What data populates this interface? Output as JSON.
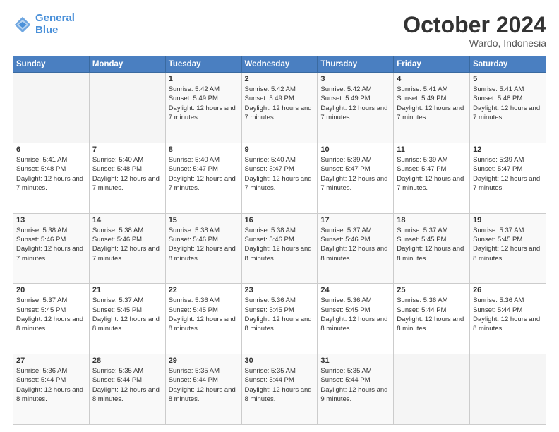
{
  "header": {
    "logo_line1": "General",
    "logo_line2": "Blue",
    "month": "October 2024",
    "location": "Wardo, Indonesia"
  },
  "days_of_week": [
    "Sunday",
    "Monday",
    "Tuesday",
    "Wednesday",
    "Thursday",
    "Friday",
    "Saturday"
  ],
  "weeks": [
    [
      {
        "day": "",
        "text": ""
      },
      {
        "day": "",
        "text": ""
      },
      {
        "day": "1",
        "text": "Sunrise: 5:42 AM\nSunset: 5:49 PM\nDaylight: 12 hours and 7 minutes."
      },
      {
        "day": "2",
        "text": "Sunrise: 5:42 AM\nSunset: 5:49 PM\nDaylight: 12 hours and 7 minutes."
      },
      {
        "day": "3",
        "text": "Sunrise: 5:42 AM\nSunset: 5:49 PM\nDaylight: 12 hours and 7 minutes."
      },
      {
        "day": "4",
        "text": "Sunrise: 5:41 AM\nSunset: 5:49 PM\nDaylight: 12 hours and 7 minutes."
      },
      {
        "day": "5",
        "text": "Sunrise: 5:41 AM\nSunset: 5:48 PM\nDaylight: 12 hours and 7 minutes."
      }
    ],
    [
      {
        "day": "6",
        "text": "Sunrise: 5:41 AM\nSunset: 5:48 PM\nDaylight: 12 hours and 7 minutes."
      },
      {
        "day": "7",
        "text": "Sunrise: 5:40 AM\nSunset: 5:48 PM\nDaylight: 12 hours and 7 minutes."
      },
      {
        "day": "8",
        "text": "Sunrise: 5:40 AM\nSunset: 5:47 PM\nDaylight: 12 hours and 7 minutes."
      },
      {
        "day": "9",
        "text": "Sunrise: 5:40 AM\nSunset: 5:47 PM\nDaylight: 12 hours and 7 minutes."
      },
      {
        "day": "10",
        "text": "Sunrise: 5:39 AM\nSunset: 5:47 PM\nDaylight: 12 hours and 7 minutes."
      },
      {
        "day": "11",
        "text": "Sunrise: 5:39 AM\nSunset: 5:47 PM\nDaylight: 12 hours and 7 minutes."
      },
      {
        "day": "12",
        "text": "Sunrise: 5:39 AM\nSunset: 5:47 PM\nDaylight: 12 hours and 7 minutes."
      }
    ],
    [
      {
        "day": "13",
        "text": "Sunrise: 5:38 AM\nSunset: 5:46 PM\nDaylight: 12 hours and 7 minutes."
      },
      {
        "day": "14",
        "text": "Sunrise: 5:38 AM\nSunset: 5:46 PM\nDaylight: 12 hours and 7 minutes."
      },
      {
        "day": "15",
        "text": "Sunrise: 5:38 AM\nSunset: 5:46 PM\nDaylight: 12 hours and 8 minutes."
      },
      {
        "day": "16",
        "text": "Sunrise: 5:38 AM\nSunset: 5:46 PM\nDaylight: 12 hours and 8 minutes."
      },
      {
        "day": "17",
        "text": "Sunrise: 5:37 AM\nSunset: 5:46 PM\nDaylight: 12 hours and 8 minutes."
      },
      {
        "day": "18",
        "text": "Sunrise: 5:37 AM\nSunset: 5:45 PM\nDaylight: 12 hours and 8 minutes."
      },
      {
        "day": "19",
        "text": "Sunrise: 5:37 AM\nSunset: 5:45 PM\nDaylight: 12 hours and 8 minutes."
      }
    ],
    [
      {
        "day": "20",
        "text": "Sunrise: 5:37 AM\nSunset: 5:45 PM\nDaylight: 12 hours and 8 minutes."
      },
      {
        "day": "21",
        "text": "Sunrise: 5:37 AM\nSunset: 5:45 PM\nDaylight: 12 hours and 8 minutes."
      },
      {
        "day": "22",
        "text": "Sunrise: 5:36 AM\nSunset: 5:45 PM\nDaylight: 12 hours and 8 minutes."
      },
      {
        "day": "23",
        "text": "Sunrise: 5:36 AM\nSunset: 5:45 PM\nDaylight: 12 hours and 8 minutes."
      },
      {
        "day": "24",
        "text": "Sunrise: 5:36 AM\nSunset: 5:45 PM\nDaylight: 12 hours and 8 minutes."
      },
      {
        "day": "25",
        "text": "Sunrise: 5:36 AM\nSunset: 5:44 PM\nDaylight: 12 hours and 8 minutes."
      },
      {
        "day": "26",
        "text": "Sunrise: 5:36 AM\nSunset: 5:44 PM\nDaylight: 12 hours and 8 minutes."
      }
    ],
    [
      {
        "day": "27",
        "text": "Sunrise: 5:36 AM\nSunset: 5:44 PM\nDaylight: 12 hours and 8 minutes."
      },
      {
        "day": "28",
        "text": "Sunrise: 5:35 AM\nSunset: 5:44 PM\nDaylight: 12 hours and 8 minutes."
      },
      {
        "day": "29",
        "text": "Sunrise: 5:35 AM\nSunset: 5:44 PM\nDaylight: 12 hours and 8 minutes."
      },
      {
        "day": "30",
        "text": "Sunrise: 5:35 AM\nSunset: 5:44 PM\nDaylight: 12 hours and 8 minutes."
      },
      {
        "day": "31",
        "text": "Sunrise: 5:35 AM\nSunset: 5:44 PM\nDaylight: 12 hours and 9 minutes."
      },
      {
        "day": "",
        "text": ""
      },
      {
        "day": "",
        "text": ""
      }
    ]
  ]
}
